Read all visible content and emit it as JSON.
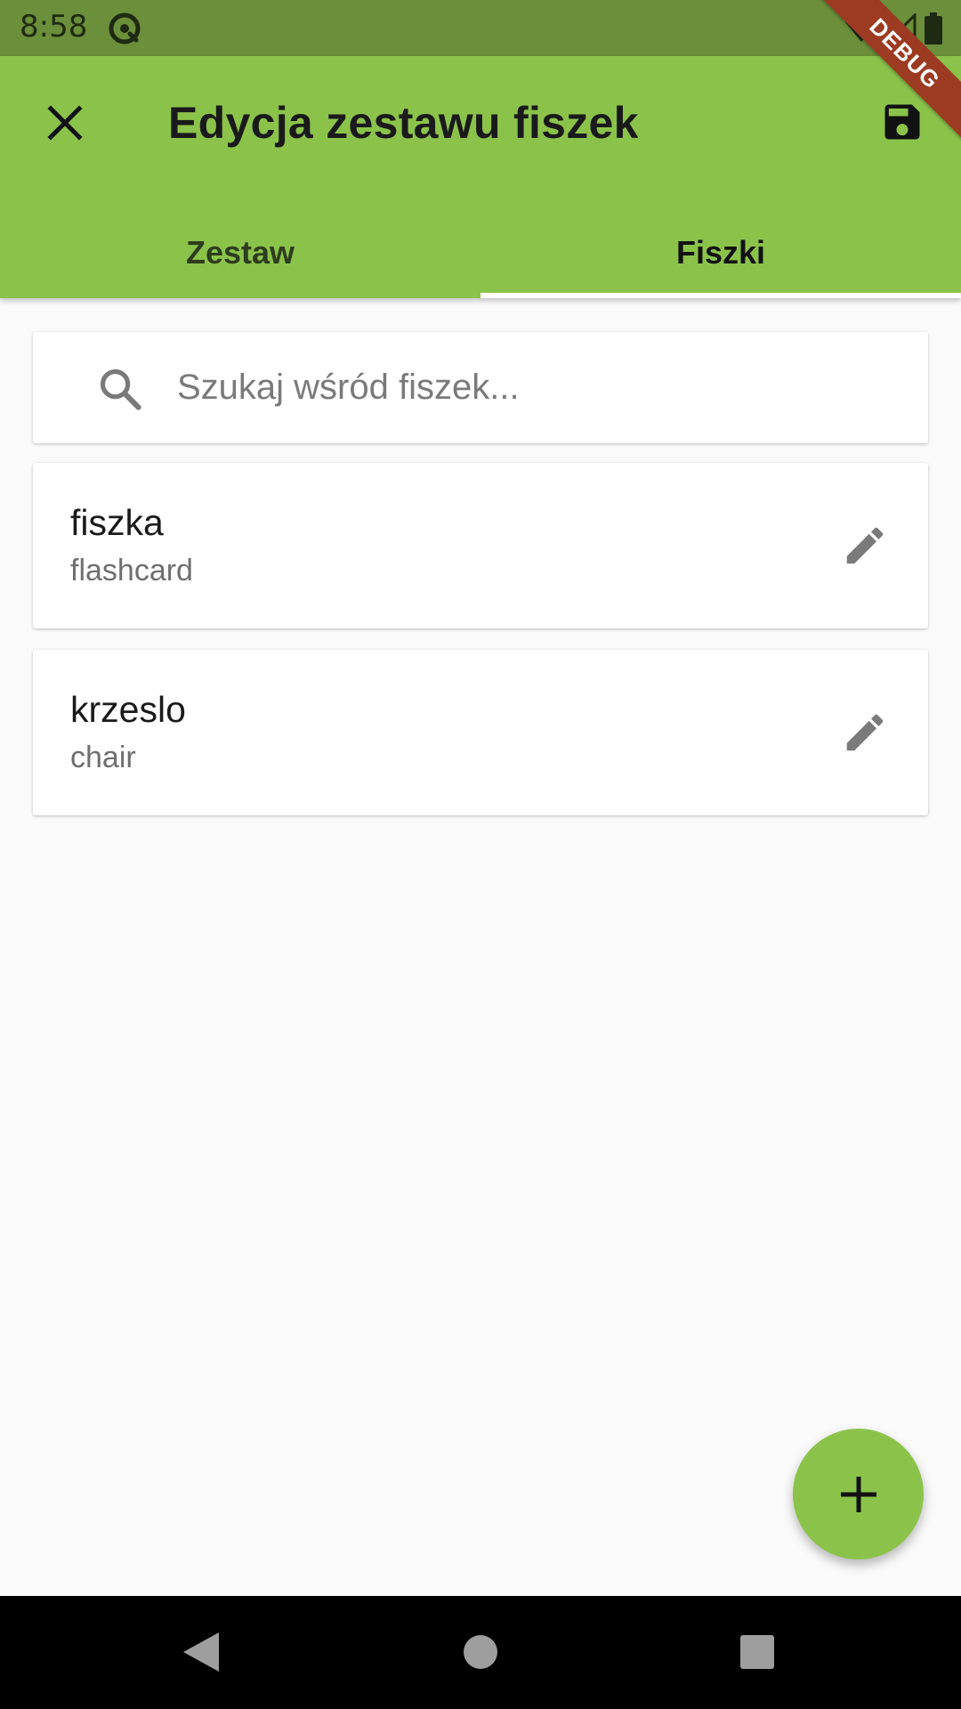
{
  "status_bar": {
    "time": "8:58"
  },
  "debug_banner": "DEBUG",
  "app_bar": {
    "title": "Edycja zestawu fiszek",
    "background": "#8bc34a",
    "tabs": [
      {
        "label": "Zestaw",
        "selected": false
      },
      {
        "label": "Fiszki",
        "selected": true
      }
    ]
  },
  "search": {
    "placeholder": "Szukaj wśród fiszek...",
    "value": ""
  },
  "flashcards": [
    {
      "front": "fiszka",
      "back": "flashcard"
    },
    {
      "front": "krzeslo",
      "back": "chair"
    }
  ],
  "icons": {
    "close": "close-icon",
    "save": "save-icon",
    "search": "search-icon",
    "edit": "pencil-icon",
    "add": "plus-icon"
  },
  "colors": {
    "accent": "#8bc34a",
    "status_bar": "#6b8f3a",
    "background": "#fafafa"
  }
}
